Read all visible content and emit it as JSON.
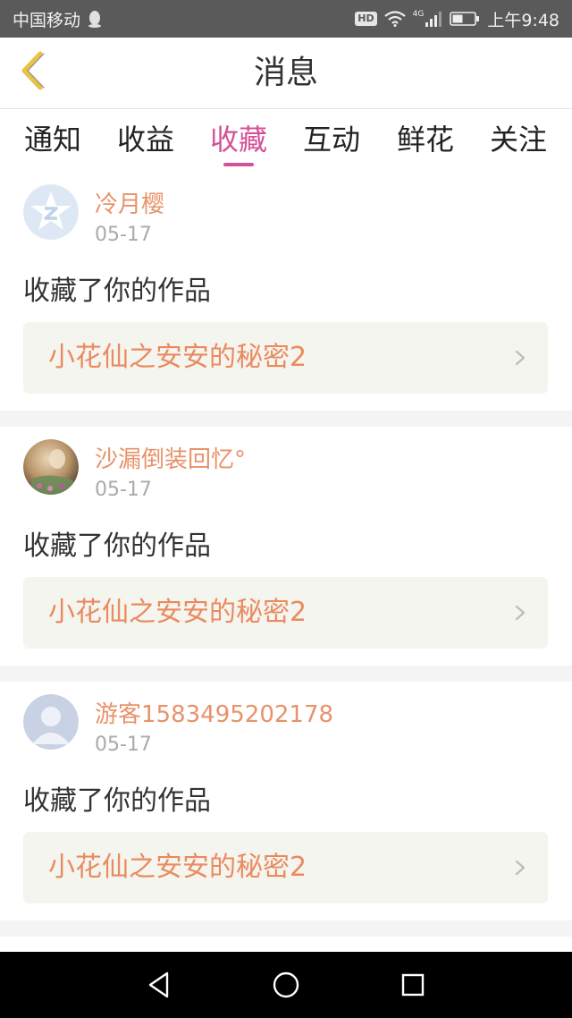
{
  "status_bar": {
    "carrier": "中国移动",
    "badge": "HD",
    "network": "4G",
    "time": "上午9:48"
  },
  "header": {
    "title": "消息"
  },
  "tabs": [
    {
      "label": "通知"
    },
    {
      "label": "收益"
    },
    {
      "label": "收藏",
      "active": true
    },
    {
      "label": "互动"
    },
    {
      "label": "鲜花"
    },
    {
      "label": "关注"
    }
  ],
  "messages": [
    {
      "user": "冷月樱",
      "date": "05-17",
      "action": "收藏了你的作品",
      "work_title": "小花仙之安安的秘密2",
      "avatar": "qq-default-avatar"
    },
    {
      "user": "沙漏倒装回忆°",
      "date": "05-17",
      "action": "收藏了你的作品",
      "work_title": "小花仙之安安的秘密2",
      "avatar": "photo-avatar"
    },
    {
      "user": "游客1583495202178",
      "date": "05-17",
      "action": "收藏了你的作品",
      "work_title": "小花仙之安安的秘密2",
      "avatar": "guest-default-avatar"
    }
  ],
  "colors": {
    "accent": "#d4509a",
    "username": "#e8926a",
    "work_title": "#ea8a5f",
    "back_arrow": "#e8c24a"
  }
}
